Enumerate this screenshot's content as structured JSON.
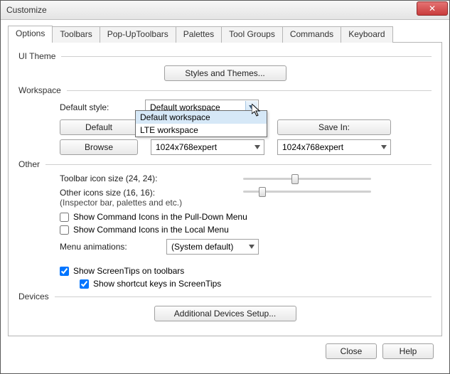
{
  "window": {
    "title": "Customize"
  },
  "tabs": {
    "items": [
      "Options",
      "Toolbars",
      "Pop-UpToolbars",
      "Palettes",
      "Tool Groups",
      "Commands",
      "Keyboard"
    ],
    "active_index": 0
  },
  "sections": {
    "ui_theme": {
      "label": "UI Theme",
      "styles_btn": "Styles and Themes..."
    },
    "workspace": {
      "label": "Workspace",
      "default_style_label": "Default style:",
      "default_style_value": "Default workspace",
      "default_style_options": [
        "Default workspace",
        "LTE workspace"
      ],
      "default_btn": "Default",
      "browse_btn": "Browse",
      "save_in_btn": "Save In:",
      "left_workspace_value": "1024x768expert",
      "right_workspace_value": "1024x768expert"
    },
    "other": {
      "label": "Other",
      "toolbar_icon_label": "Toolbar icon size (24, 24):",
      "other_icons_label": "Other icons size (16, 16):",
      "other_icons_sub": "(Inspector bar, palettes and etc.)",
      "chk_pulldown": {
        "label": "Show Command Icons in the Pull-Down Menu",
        "checked": false
      },
      "chk_local": {
        "label": "Show Command Icons in the Local Menu",
        "checked": false
      },
      "menu_anim_label": "Menu animations:",
      "menu_anim_value": "(System default)",
      "chk_screentips": {
        "label": "Show ScreenTips on toolbars",
        "checked": true
      },
      "chk_shortcut": {
        "label": "Show shortcut keys in ScreenTips",
        "checked": true
      }
    },
    "devices": {
      "label": "Devices",
      "btn": "Additional Devices Setup..."
    }
  },
  "footer": {
    "close": "Close",
    "help": "Help"
  }
}
